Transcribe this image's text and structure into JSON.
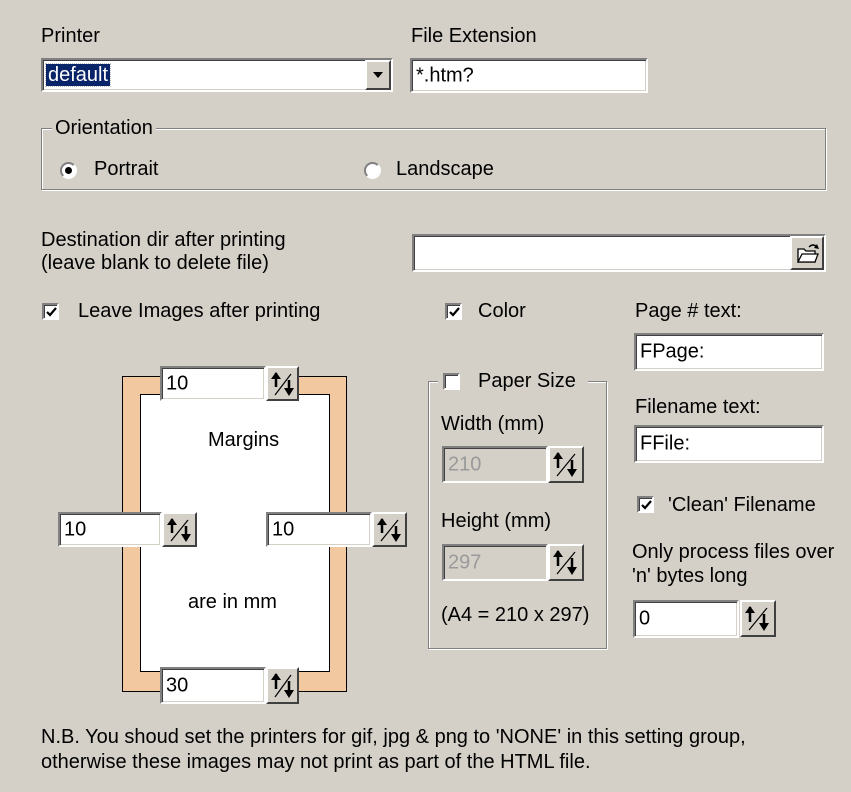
{
  "printer": {
    "label": "Printer",
    "value": "default"
  },
  "file_extension": {
    "label": "File Extension",
    "value": "*.htm?"
  },
  "orientation": {
    "legend": "Orientation",
    "portrait": "Portrait",
    "landscape": "Landscape",
    "selected": "Portrait"
  },
  "destination": {
    "label_line1": "Destination dir after printing",
    "label_line2": "(leave blank to delete file)",
    "value": ""
  },
  "leave_images": {
    "label": "Leave Images after printing",
    "checked": true
  },
  "color": {
    "label": "Color",
    "checked": true
  },
  "page_text": {
    "label": "Page # text:",
    "value": "FPage:"
  },
  "filename_text": {
    "label": "Filename text:",
    "value": "FFile:"
  },
  "clean_filename": {
    "label": "'Clean' Filename",
    "checked": true
  },
  "min_size": {
    "label_line1": "Only process files over",
    "label_line2": "'n' bytes long",
    "value": "0"
  },
  "margins": {
    "top": "10",
    "left": "10",
    "right": "10",
    "bottom": "30",
    "caption1": "Margins",
    "caption2": "are in mm",
    "page_border_color": "#f2c8a0"
  },
  "paper_size": {
    "legend": "Paper Size",
    "checked": false,
    "width_label": "Width (mm)",
    "width_value": "210",
    "height_label": "Height (mm)",
    "height_value": "297",
    "note": "(A4 = 210 x 297)"
  },
  "note": {
    "line1": "N.B. You shoud set the printers for gif, jpg & png to 'NONE' in this setting group,",
    "line2": "otherwise these images may not print as part of the HTML file."
  },
  "colors": {
    "background": "#d4d0c8",
    "selection": "#0a246a",
    "selection_text": "#ffffff"
  }
}
